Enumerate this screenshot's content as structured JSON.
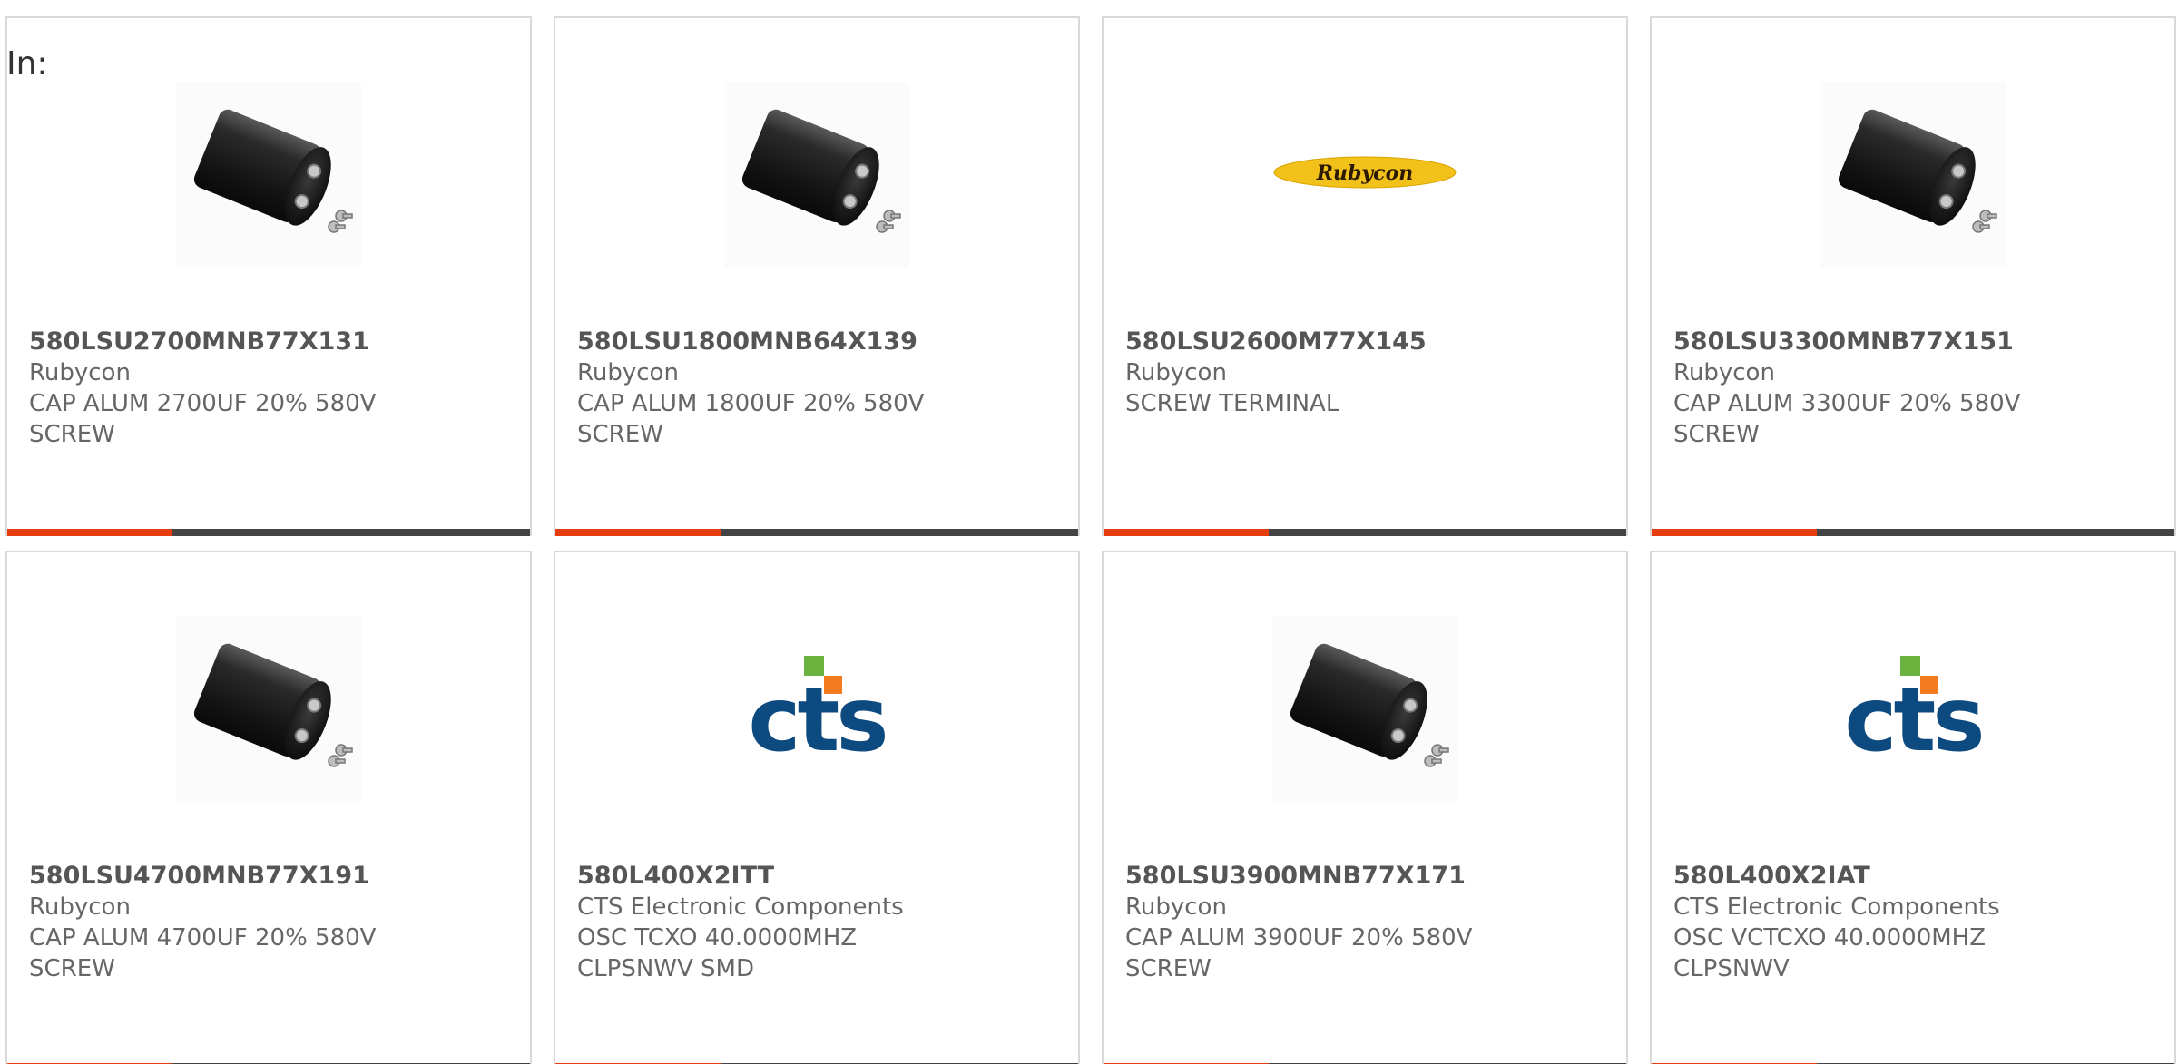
{
  "header": {
    "in_label": "In:"
  },
  "colors": {
    "accent": "#e63d0e",
    "bar": "#444444",
    "rubycon_yellow": "#f2c21a",
    "cts_blue": "#0d4a80",
    "cts_orange": "#f47b20",
    "cts_green": "#6ab23e"
  },
  "cards": [
    {
      "part_number": "580LSU2700MNB77X131",
      "manufacturer": "Rubycon",
      "desc1": "CAP ALUM 2700UF 20% 580V",
      "desc2": "SCREW",
      "image": "capacitor-image"
    },
    {
      "part_number": "580LSU1800MNB64X139",
      "manufacturer": "Rubycon",
      "desc1": "CAP ALUM 1800UF 20% 580V",
      "desc2": "SCREW",
      "image": "capacitor-image"
    },
    {
      "part_number": "580LSU2600M77X145",
      "manufacturer": "Rubycon",
      "desc1": "SCREW TERMINAL",
      "desc2": "",
      "image": "rubycon-logo",
      "logo_text": "Rubycon"
    },
    {
      "part_number": "580LSU3300MNB77X151",
      "manufacturer": "Rubycon",
      "desc1": "CAP ALUM 3300UF 20% 580V",
      "desc2": "SCREW",
      "image": "capacitor-image"
    },
    {
      "part_number": "580LSU4700MNB77X191",
      "manufacturer": "Rubycon",
      "desc1": "CAP ALUM 4700UF 20% 580V",
      "desc2": "SCREW",
      "image": "capacitor-image"
    },
    {
      "part_number": "580L400X2ITT",
      "manufacturer": "CTS Electronic Components",
      "desc1": "OSC TCXO 40.0000MHZ",
      "desc2": "CLPSNWV SMD",
      "image": "cts-logo",
      "logo_text": "cts"
    },
    {
      "part_number": "580LSU3900MNB77X171",
      "manufacturer": "Rubycon",
      "desc1": "CAP ALUM 3900UF 20% 580V",
      "desc2": "SCREW",
      "image": "capacitor-image"
    },
    {
      "part_number": "580L400X2IAT",
      "manufacturer": "CTS Electronic Components",
      "desc1": "OSC VCTCXO 40.0000MHZ",
      "desc2": "CLPSNWV",
      "image": "cts-logo",
      "logo_text": "cts"
    }
  ]
}
